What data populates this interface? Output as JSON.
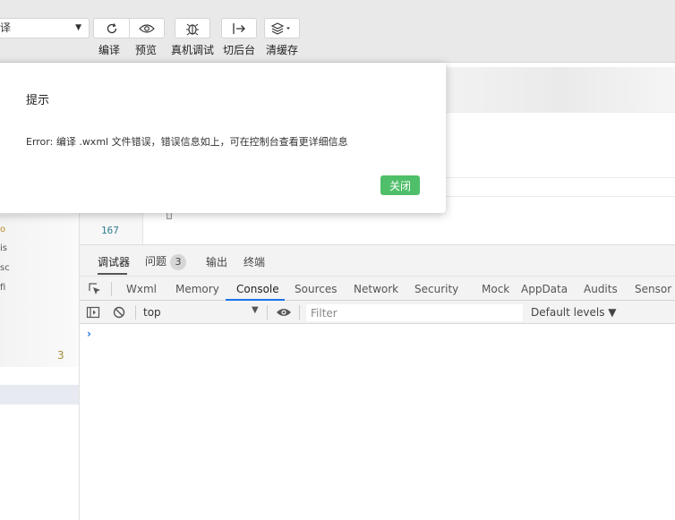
{
  "toolbar": {
    "mode_select_value": "译",
    "compile_label": "编译",
    "preview_label": "预览",
    "remote_debug_label": "真机调试",
    "background_label": "切后台",
    "clear_cache_label": "清缓存"
  },
  "sidebar": {
    "count": "3",
    "fragments": [
      "o",
      "is",
      "sc",
      "fi"
    ]
  },
  "editor": {
    "line_number": "167"
  },
  "devtools": {
    "tabs": [
      {
        "label": "调试器"
      },
      {
        "label": "问题",
        "badge": "3"
      },
      {
        "label": "输出"
      },
      {
        "label": "终端"
      }
    ],
    "panels": [
      "Wxml",
      "Memory",
      "Console",
      "Sources",
      "Network",
      "Security",
      "Mock",
      "AppData",
      "Audits",
      "Sensor"
    ],
    "active_panel": "Console",
    "console": {
      "context": "top",
      "filter_placeholder": "Filter",
      "levels": "Default levels ▼",
      "prompt": "›"
    }
  },
  "modal": {
    "title": "提示",
    "message": "Error: 编译 .wxml 文件错误，错误信息如上，可在控制台查看更详细信息",
    "close_label": "关闭",
    "close_color": "#4fbf6a"
  }
}
